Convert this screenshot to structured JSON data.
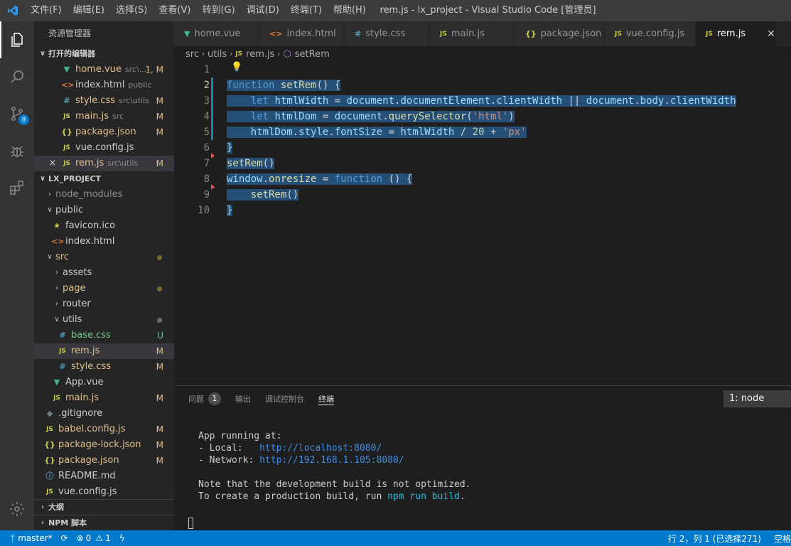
{
  "menu": [
    "文件(F)",
    "编辑(E)",
    "选择(S)",
    "查看(V)",
    "转到(G)",
    "调试(D)",
    "终端(T)",
    "帮助(H)"
  ],
  "window_title": "rem.js - lx_project - Visual Studio Code [管理员]",
  "activity": {
    "scm_badge": "8"
  },
  "sidebar": {
    "title": "资源管理器",
    "open_editors": {
      "header": "打开的编辑器",
      "items": [
        {
          "name": "home.vue",
          "desc": "src\\...",
          "status": "1, M"
        },
        {
          "name": "index.html",
          "desc": "public",
          "status": ""
        },
        {
          "name": "style.css",
          "desc": "src\\utils",
          "status": "M"
        },
        {
          "name": "main.js",
          "desc": "src",
          "status": "M"
        },
        {
          "name": "package.json",
          "desc": "",
          "status": "M"
        },
        {
          "name": "vue.config.js",
          "desc": "",
          "status": ""
        },
        {
          "name": "rem.js",
          "desc": "src\\utils",
          "status": "M"
        }
      ]
    },
    "project": {
      "header": "LX_PROJECT",
      "items": [
        {
          "name": "node_modules",
          "status": ""
        },
        {
          "name": "public",
          "status": ""
        },
        {
          "name": "favicon.ico",
          "status": ""
        },
        {
          "name": "index.html",
          "status": ""
        },
        {
          "name": "src",
          "status": ""
        },
        {
          "name": "assets",
          "status": ""
        },
        {
          "name": "page",
          "status": ""
        },
        {
          "name": "router",
          "status": ""
        },
        {
          "name": "utils",
          "status": ""
        },
        {
          "name": "base.css",
          "status": "U"
        },
        {
          "name": "rem.js",
          "status": "M"
        },
        {
          "name": "style.css",
          "status": "M"
        },
        {
          "name": "App.vue",
          "status": ""
        },
        {
          "name": "main.js",
          "status": "M"
        },
        {
          "name": ".gitignore",
          "status": ""
        },
        {
          "name": "babel.config.js",
          "status": "M"
        },
        {
          "name": "package-lock.json",
          "status": "M"
        },
        {
          "name": "package.json",
          "status": "M"
        },
        {
          "name": "README.md",
          "status": ""
        },
        {
          "name": "vue.config.js",
          "status": ""
        }
      ]
    },
    "outline": "大纲",
    "npm": "NPM 脚本"
  },
  "tabs": [
    "home.vue",
    "index.html",
    "style.css",
    "main.js",
    "package.json",
    "vue.config.js",
    "rem.js"
  ],
  "breadcrumb": [
    "src",
    "utils",
    "rem.js",
    "setRem"
  ],
  "editor": {
    "line_numbers": [
      "1",
      "2",
      "3",
      "4",
      "5",
      "6",
      "7",
      "8",
      "9",
      "10"
    ],
    "lines": [
      [],
      [
        [
          "function",
          "k"
        ],
        [
          " ",
          "p"
        ],
        [
          "setRem",
          "f"
        ],
        [
          "() {",
          "p"
        ]
      ],
      [
        [
          "    ",
          "p"
        ],
        [
          "let",
          "k"
        ],
        [
          " ",
          "p"
        ],
        [
          "htmlWidth",
          "v"
        ],
        [
          " = ",
          "p"
        ],
        [
          "document",
          "v"
        ],
        [
          ".",
          "p"
        ],
        [
          "documentElement",
          "v"
        ],
        [
          ".",
          "p"
        ],
        [
          "clientWidth",
          "v"
        ],
        [
          " || ",
          "p"
        ],
        [
          "document",
          "v"
        ],
        [
          ".",
          "p"
        ],
        [
          "body",
          "v"
        ],
        [
          ".",
          "p"
        ],
        [
          "clientWidth",
          "v"
        ]
      ],
      [
        [
          "    ",
          "p"
        ],
        [
          "let",
          "k"
        ],
        [
          " ",
          "p"
        ],
        [
          "htmlDom",
          "v"
        ],
        [
          " = ",
          "p"
        ],
        [
          "document",
          "v"
        ],
        [
          ".",
          "p"
        ],
        [
          "querySelector",
          "f"
        ],
        [
          "(",
          "p"
        ],
        [
          "'html'",
          "s"
        ],
        [
          ")",
          "p"
        ]
      ],
      [
        [
          "    ",
          "p"
        ],
        [
          "htmlDom",
          "v"
        ],
        [
          ".",
          "p"
        ],
        [
          "style",
          "v"
        ],
        [
          ".",
          "p"
        ],
        [
          "fontSize",
          "v"
        ],
        [
          " = ",
          "p"
        ],
        [
          "htmlWidth",
          "v"
        ],
        [
          " / ",
          "p"
        ],
        [
          "20",
          "n"
        ],
        [
          " + ",
          "p"
        ],
        [
          "'px'",
          "s"
        ]
      ],
      [
        [
          "}",
          "p"
        ]
      ],
      [
        [
          "setRem",
          "f"
        ],
        [
          "()",
          "p"
        ]
      ],
      [
        [
          "window",
          "v"
        ],
        [
          ".",
          "p"
        ],
        [
          "onresize",
          "f"
        ],
        [
          " = ",
          "p"
        ],
        [
          "function",
          "k"
        ],
        [
          " () {",
          "p"
        ]
      ],
      [
        [
          "    ",
          "p"
        ],
        [
          "setRem",
          "f"
        ],
        [
          "()",
          "p"
        ]
      ],
      [
        [
          "}",
          "p"
        ]
      ]
    ]
  },
  "panel": {
    "tabs": [
      "问题",
      "输出",
      "调试控制台",
      "终端"
    ],
    "problems_count": "1",
    "terminal_select": "1: node",
    "terminal": {
      "l1": "App running at:",
      "l2_label": "- Local:   ",
      "l2_url": "http://localhost:8080/",
      "l3_label": "- Network: ",
      "l3_url": "http://192.168.1.105:8080/",
      "l4": "Note that the development build is not optimized.",
      "l5_pre": "To create a production build, run ",
      "l5_cmd": "npm run build",
      "l5_post": "."
    }
  },
  "status": {
    "branch": "master*",
    "errors": "0",
    "warnings": "1",
    "position": "行 2，列 1 (已选择271)",
    "spaces": "空格"
  }
}
